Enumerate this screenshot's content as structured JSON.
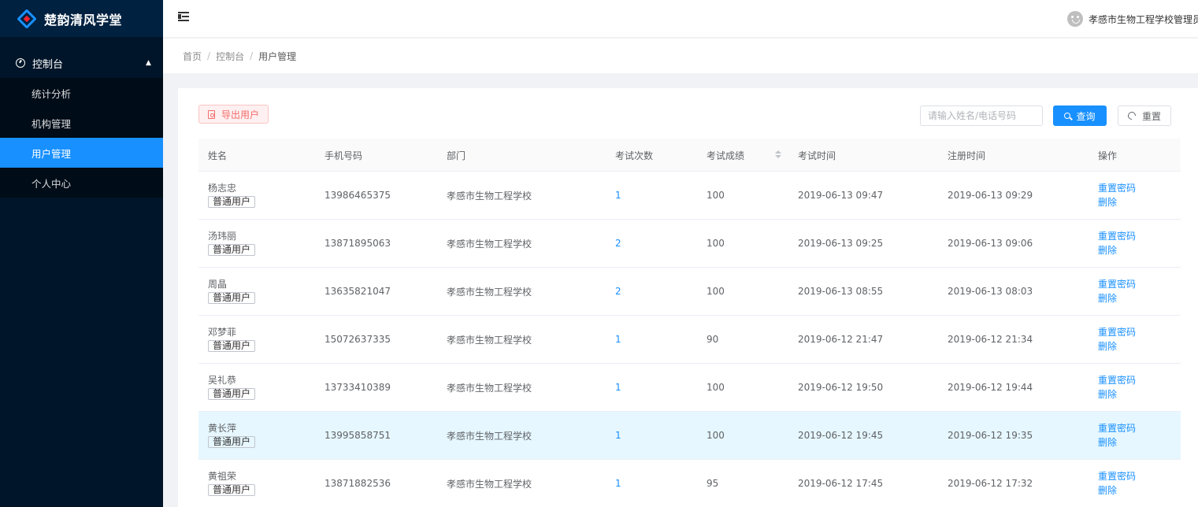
{
  "app": {
    "title": "楚韵清风学堂"
  },
  "sidebar": {
    "group": {
      "label": "控制台",
      "icon": "dashboard-icon"
    },
    "items": [
      {
        "label": "统计分析",
        "active": false
      },
      {
        "label": "机构管理",
        "active": false
      },
      {
        "label": "用户管理",
        "active": true
      },
      {
        "label": "个人中心",
        "active": false
      }
    ]
  },
  "header": {
    "user_name": "孝感市生物工程学校管理员"
  },
  "breadcrumb": [
    "首页",
    "控制台",
    "用户管理"
  ],
  "toolbar": {
    "export_label": "导出用户",
    "search_placeholder": "请输入姓名/电话号码",
    "search_value": "",
    "query_label": "查询",
    "reset_label": "重置"
  },
  "table": {
    "columns": [
      "姓名",
      "手机号码",
      "部门",
      "考试次数",
      "考试成绩",
      "考试时间",
      "注册时间",
      "操作"
    ],
    "actions": {
      "reset_password": "重置密码",
      "delete": "删除"
    },
    "rows": [
      {
        "name": "杨志忠",
        "role": "普通用户",
        "phone": "13986465375",
        "dept": "孝感市生物工程学校",
        "exam_count": "1",
        "score": "100",
        "exam_time": "2019-06-13 09:47",
        "reg_time": "2019-06-13 09:29"
      },
      {
        "name": "汤玮丽",
        "role": "普通用户",
        "phone": "13871895063",
        "dept": "孝感市生物工程学校",
        "exam_count": "2",
        "score": "100",
        "exam_time": "2019-06-13 09:25",
        "reg_time": "2019-06-13 09:06"
      },
      {
        "name": "周晶",
        "role": "普通用户",
        "phone": "13635821047",
        "dept": "孝感市生物工程学校",
        "exam_count": "2",
        "score": "100",
        "exam_time": "2019-06-13 08:55",
        "reg_time": "2019-06-13 08:03"
      },
      {
        "name": "邓梦菲",
        "role": "普通用户",
        "phone": "15072637335",
        "dept": "孝感市生物工程学校",
        "exam_count": "1",
        "score": "90",
        "exam_time": "2019-06-12 21:47",
        "reg_time": "2019-06-12 21:34"
      },
      {
        "name": "吴礼恭",
        "role": "普通用户",
        "phone": "13733410389",
        "dept": "孝感市生物工程学校",
        "exam_count": "1",
        "score": "100",
        "exam_time": "2019-06-12 19:50",
        "reg_time": "2019-06-12 19:44"
      },
      {
        "name": "黄长萍",
        "role": "普通用户",
        "phone": "13995858751",
        "dept": "孝感市生物工程学校",
        "exam_count": "1",
        "score": "100",
        "exam_time": "2019-06-12 19:45",
        "reg_time": "2019-06-12 19:35"
      },
      {
        "name": "黄祖荣",
        "role": "普通用户",
        "phone": "13871882536",
        "dept": "孝感市生物工程学校",
        "exam_count": "1",
        "score": "95",
        "exam_time": "2019-06-12 17:45",
        "reg_time": "2019-06-12 17:32"
      }
    ]
  },
  "colors": {
    "primary": "#1890ff",
    "sidebar_bg": "#001529",
    "danger": "#f56c6c",
    "row_hover": "#e6f7ff"
  }
}
